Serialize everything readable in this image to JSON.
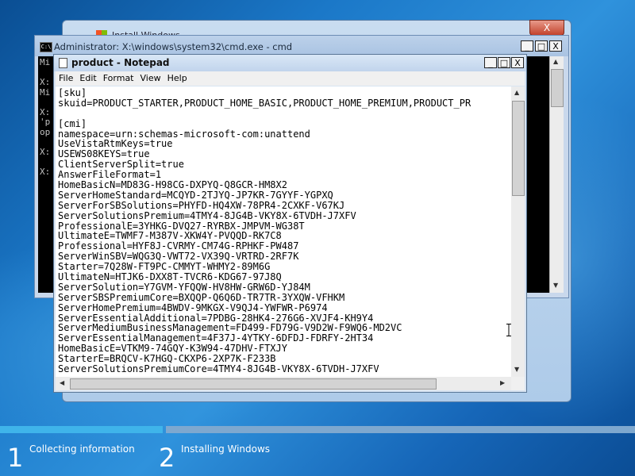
{
  "install_window": {
    "title": "Install Windows",
    "close": "X"
  },
  "cmd": {
    "title": "Administrator: X:\\windows\\system32\\cmd.exe - cmd",
    "lines": [
      "Mi",
      "",
      "X:",
      "Mi",
      "",
      "X:",
      "'p",
      "op",
      "",
      "X:",
      "",
      "X:"
    ],
    "buttons": {
      "minimize": "_",
      "maximize": "□",
      "close": "X"
    }
  },
  "notepad": {
    "title": "product - Notepad",
    "menu": [
      "File",
      "Edit",
      "Format",
      "View",
      "Help"
    ],
    "buttons": {
      "minimize": "_",
      "maximize": "□",
      "close": "X"
    },
    "lines": [
      "[sku]",
      "skuid=PRODUCT_STARTER,PRODUCT_HOME_BASIC,PRODUCT_HOME_PREMIUM,PRODUCT_PR",
      "",
      "[cmi]",
      "namespace=urn:schemas-microsoft-com:unattend",
      "UseVistaRtmKeys=true",
      "USEWS08KEYS=true",
      "ClientServerSplit=true",
      "AnswerFileFormat=1",
      "HomeBasicN=MD83G-H98CG-DXPYQ-Q8GCR-HM8X2",
      "ServerHomeStandard=MCQYD-2TJYQ-JP7KR-7GYYF-YGPXQ",
      "ServerForSBSolutions=PHYFD-HQ4XW-78PR4-2CXKF-V67KJ",
      "ServerSolutionsPremium=4TMY4-8JG4B-VKY8X-6TVDH-J7XFV",
      "ProfessionalE=3YHKG-DVQ27-RYRBX-JMPVM-WG38T",
      "UltimateE=TWMF7-M387V-XKW4Y-PVQQD-RK7C8",
      "Professional=HYF8J-CVRMY-CM74G-RPHKF-PW487",
      "ServerWinSBV=WQG3Q-VWT72-VX39Q-VRTRD-2RF7K",
      "Starter=7Q28W-FT9PC-CMMYT-WHMY2-89M6G",
      "UltimateN=HTJK6-DXX8T-TVCR6-KDG67-97J8Q",
      "ServerSolution=Y7GVM-YFQQW-HV8HW-GRW6D-YJ84M",
      "ServerSBSPremiumCore=BXQQP-Q6Q6D-TR7TR-3YXQW-VFHKM",
      "ServerHomePremium=4BWDV-9MKGX-V9QJ4-YWFWR-P6974",
      "ServerEssentialAdditional=7PDBG-28HK4-276G6-XVJF4-KH9Y4",
      "ServerMediumBusinessManagement=FD499-FD79G-V9D2W-F9WQ6-MD2VC",
      "ServerEssentialManagement=4F37J-4YTKY-6DFDJ-FDRFY-2HT34",
      "HomeBasicE=VTKM9-74GQY-K3W94-47DHV-FTXJY",
      "StarterE=BRQCV-K7HGQ-CKXP6-2XP7K-F233B",
      "ServerSolutionsPremiumCore=4TMY4-8JG4B-VKY8X-6TVDH-J7XFV"
    ]
  },
  "setup_progress": {
    "steps": [
      {
        "number": "1",
        "label": "Collecting information"
      },
      {
        "number": "2",
        "label": "Installing Windows"
      }
    ],
    "colors": {
      "done": "#3fb4ea",
      "pending": "#7ea8cf"
    }
  }
}
